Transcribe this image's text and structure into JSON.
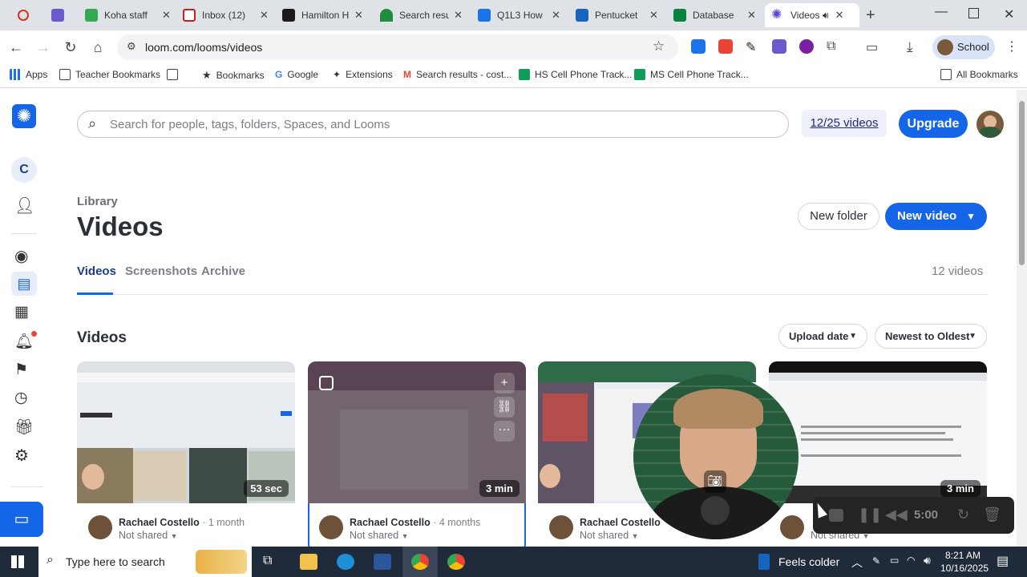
{
  "browser": {
    "tabs": [
      {
        "title": "",
        "color": "#d93025"
      },
      {
        "title": "",
        "color": "#6a5acd"
      },
      {
        "title": "Koha staff",
        "color": "#34a853"
      },
      {
        "title": "Inbox (12)",
        "color": "#c5221f"
      },
      {
        "title": "Hamilton H",
        "color": "#1a1a1a"
      },
      {
        "title": "Search resu",
        "color": "#1e8e3e"
      },
      {
        "title": "Q1L3 How",
        "color": "#1a73e8"
      },
      {
        "title": "Pentucket",
        "color": "#1565c0"
      },
      {
        "title": "Database",
        "color": "#0b8043"
      },
      {
        "title": "Videos",
        "color": "#5b3fd6"
      }
    ],
    "url": "loom.com/looms/videos",
    "profile_label": "School",
    "bookmarks": [
      {
        "label": "Apps",
        "icon": "apps-grid-icon"
      },
      {
        "label": "Teacher Bookmarks",
        "icon": "folder-icon"
      },
      {
        "label": "",
        "icon": "grid-icon"
      },
      {
        "label": "Bookmarks",
        "icon": "star-icon"
      },
      {
        "label": "Google",
        "icon": "google-icon"
      },
      {
        "label": "Extensions",
        "icon": "puzzle-icon"
      },
      {
        "label": "Search results - cost...",
        "icon": "gmail-icon"
      },
      {
        "label": "HS Cell Phone Track...",
        "icon": "sheets-icon"
      },
      {
        "label": "MS Cell Phone Track...",
        "icon": "sheets-icon"
      }
    ],
    "all_bookmarks": "All Bookmarks"
  },
  "loom": {
    "workspace_initial": "C",
    "search_placeholder": "Search for people, tags, folders, Spaces, and Looms",
    "video_limit": "12/25 videos",
    "upgrade_label": "Upgrade",
    "breadcrumb": "Library",
    "page_title": "Videos",
    "new_folder_label": "New folder",
    "new_video_label": "New video",
    "tabs": [
      "Videos",
      "Screenshots",
      "Archive"
    ],
    "video_count": "12 videos",
    "section_title": "Videos",
    "sort_by": "Upload date",
    "sort_order": "Newest to Oldest",
    "cards": [
      {
        "duration": "53 sec",
        "author": "Rachael Costello",
        "age": "1 month",
        "sharing": "Not shared"
      },
      {
        "duration": "3 min",
        "author": "Rachael Costello",
        "age": "4 months",
        "sharing": "Not shared"
      },
      {
        "duration": "",
        "author": "Rachael Costello",
        "age": "",
        "sharing": "Not shared"
      },
      {
        "duration": "3 min",
        "author": "",
        "age": "",
        "sharing": "Not shared"
      }
    ],
    "recording_timer": "5:00",
    "accent": "#1565e8"
  },
  "taskbar": {
    "search_placeholder": "Type here to search",
    "weather": "Feels colder",
    "time": "8:21 AM",
    "date": "10/16/2025"
  }
}
